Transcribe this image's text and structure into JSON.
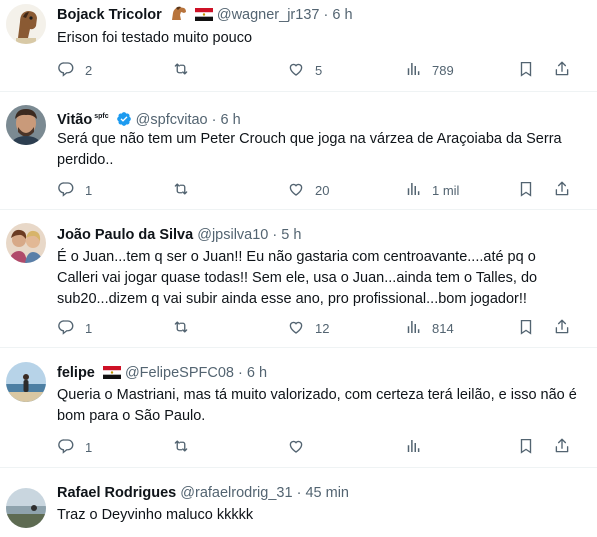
{
  "tweets": [
    {
      "name": "Bojack Tricolor",
      "handle": "@wagner_jr137",
      "time": "6 h",
      "text": "Erison foi testado muito pouco",
      "replies": "2",
      "retweets": "",
      "likes": "5",
      "views": "789",
      "flags": [
        "horse-emoji",
        "egypt-flag"
      ]
    },
    {
      "name": "Vitão",
      "affiliate": "spfc",
      "handle": "@spfcvitao",
      "time": "6 h",
      "text": "Será que não tem um Peter Crouch que joga na várzea de Araçoiaba da Serra perdido..",
      "replies": "1",
      "retweets": "",
      "likes": "20",
      "views": "1 mil",
      "verified": true
    },
    {
      "name": "João Paulo da Silva",
      "handle": "@jpsilva10",
      "time": "5 h",
      "text": "É o Juan...tem q ser o Juan!! Eu não gastaria com centroavante....até pq o Calleri vai jogar quase todas!! Sem ele, usa o Juan...ainda tem o Talles, do sub20...dizem q vai subir ainda esse ano, pro profissional...bom jogador!!",
      "replies": "1",
      "retweets": "",
      "likes": "12",
      "views": "814"
    },
    {
      "name": "felipe",
      "handle": "@FelipeSPFC08",
      "time": "6 h",
      "text": "Queria o Mastriani, mas tá muito valorizado, com certeza terá leilão, e isso não é bom para o São Paulo.",
      "replies": "1",
      "retweets": "",
      "likes": "",
      "views": "",
      "flags": [
        "egypt-flag"
      ]
    },
    {
      "name": "Rafael Rodrigues",
      "handle": "@rafaelrodrig_31",
      "time": "45 min",
      "text": "Traz o Deyvinho maluco kkkkk"
    }
  ],
  "separator": "·",
  "colors": {
    "text": "#0f1419",
    "secondary": "#536471",
    "verified": "#1d9bf0",
    "divider": "#eff3f4"
  }
}
